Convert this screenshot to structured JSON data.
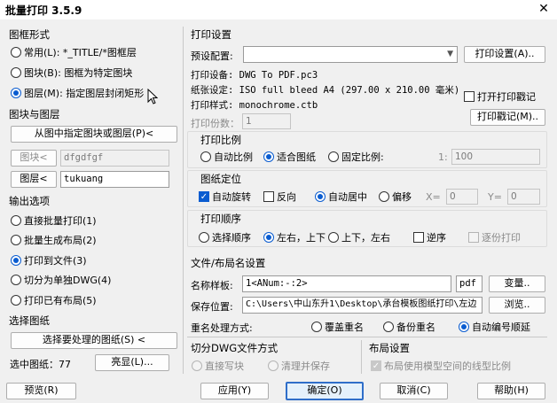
{
  "window": {
    "title": "批量打印 3.5.9",
    "close": "✕"
  },
  "frame_shape": {
    "label": "图框形式",
    "options": [
      {
        "label": "常用(L): *_TITLE/*图框层",
        "selected": false
      },
      {
        "label": "图块(B): 图框为特定图块",
        "selected": false
      },
      {
        "label": "图层(M): 指定图层封闭矩形",
        "selected": true
      }
    ]
  },
  "blocks_layers": {
    "label": "图块与图层",
    "pick_button": "从图中指定图块或图层(P)<",
    "block_button": "图块<",
    "block_value": "dfgdfgf",
    "layer_button": "图层<",
    "layer_value": "tukuang"
  },
  "output": {
    "label": "输出选项",
    "options": [
      {
        "label": "直接批量打印(1)",
        "selected": false
      },
      {
        "label": "批量生成布局(2)",
        "selected": false
      },
      {
        "label": "打印到文件(3)",
        "selected": true
      },
      {
        "label": "切分为单独DWG(4)",
        "selected": false
      },
      {
        "label": "打印已有布局(5)",
        "selected": false
      }
    ]
  },
  "select_drawings": {
    "label": "选择图纸",
    "button": "选择要处理的图纸(S) <",
    "count_label": "选中图纸：77",
    "highlight_button": "亮显(L)..."
  },
  "print_settings": {
    "label": "打印设置",
    "preset_label": "预设配置:",
    "preset_value": "",
    "print_settings_button": "打印设置(A)..",
    "device": "打印设备: DWG To PDF.pc3",
    "paper": "纸张设定: ISO full bleed A4 (297.00 x 210.00 毫米)",
    "style": "打印样式: monochrome.ctb",
    "copies_label": "打印份数：",
    "copies_value": "1",
    "open_log": "打开打印戳记",
    "log_button": "打印戳记(M).."
  },
  "scale": {
    "label": "打印比例",
    "auto": "自动比例",
    "fit": "适合图纸",
    "fixed": "固定比例:",
    "ratio_prefix": "1:",
    "ratio_value": "100"
  },
  "positioning": {
    "label": "图纸定位",
    "rotate": "自动旋转",
    "reverse": "反向",
    "center": "自动居中",
    "offset": "偏移",
    "x_label": "X=",
    "x_value": "0",
    "y_label": "Y=",
    "y_value": "0"
  },
  "order": {
    "label": "打印顺序",
    "select": "选择顺序",
    "lr_tb": "左右，上下",
    "tb_lr": "上下，左右",
    "reverse": "逆序",
    "mirror": "逐份打印"
  },
  "file_layout": {
    "label": "文件/布局名设置",
    "name_label": "名称样板:",
    "name_value": "1<ANum:-:2>",
    "ext_value": "pdf",
    "var_button": "变量..",
    "save_label": "保存位置:",
    "save_value": "C:\\Users\\中山东升1\\Desktop\\承台模板图纸打印\\左边",
    "browse_button": "浏览..",
    "rename_label": "重名处理方式:",
    "overwrite": "覆盖重名",
    "backup": "备份重名",
    "auto_number": "自动编号顺延"
  },
  "split_dwg": {
    "label": "切分DWG文件方式",
    "direct": "直接写块",
    "purge": "清理并保存"
  },
  "layout_settings": {
    "label": "布局设置",
    "model_linetype": "布局使用模型空间的线型比例"
  },
  "bottom": {
    "preview": "预览(R)",
    "apply": "应用(Y)",
    "ok": "确定(O)",
    "cancel": "取消(C)",
    "help": "帮助(H)"
  },
  "colors": {
    "accent": "#0a5cd0",
    "default_border": "#2f6ec9"
  }
}
